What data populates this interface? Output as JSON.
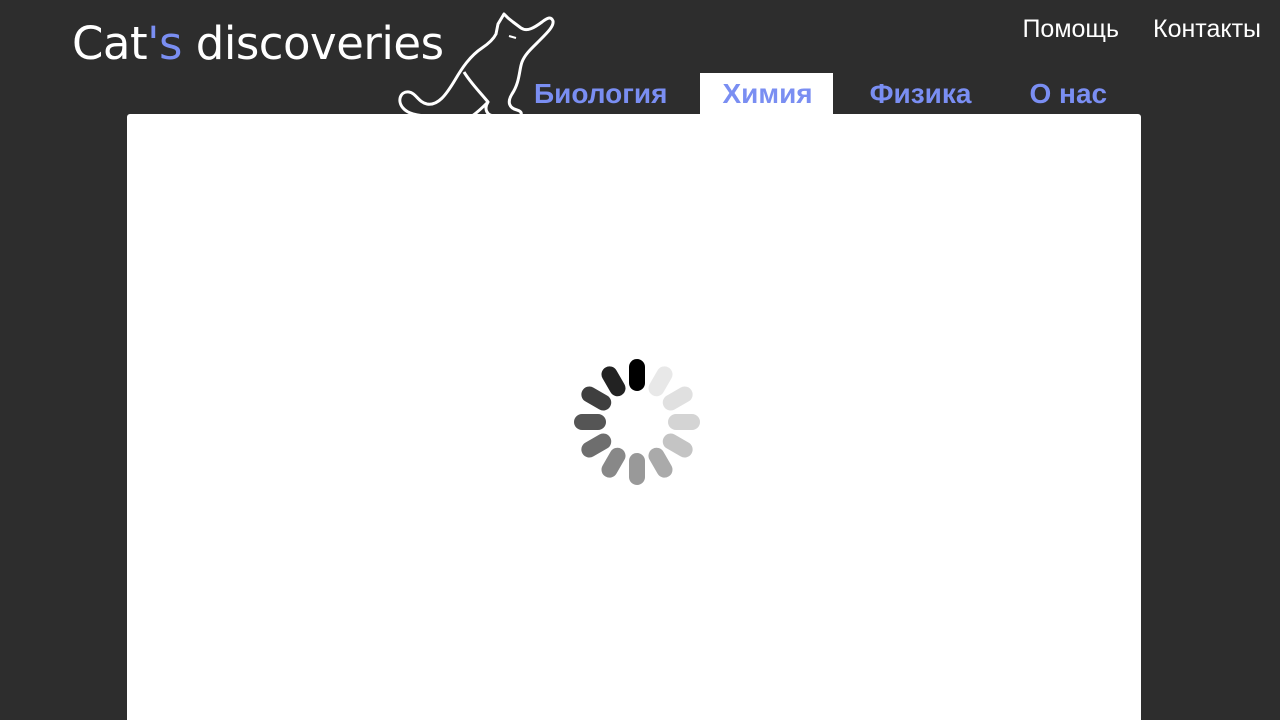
{
  "header": {
    "logo": {
      "part1": "Cat",
      "accent": "'s",
      "part2": " discoveries"
    },
    "utility_links": [
      {
        "label": "Помощь"
      },
      {
        "label": "Контакты"
      }
    ]
  },
  "nav": {
    "tabs": [
      {
        "label": "Биология",
        "active": false
      },
      {
        "label": "Химия",
        "active": true
      },
      {
        "label": "Физика",
        "active": false
      },
      {
        "label": "О нас",
        "active": false
      }
    ]
  },
  "content": {
    "loading_icon": "spinner-icon",
    "decoration_icon": "cat-silhouette-icon"
  },
  "colors": {
    "background": "#2d2d2d",
    "accent": "#7a8ef2",
    "panel": "#ffffff"
  }
}
